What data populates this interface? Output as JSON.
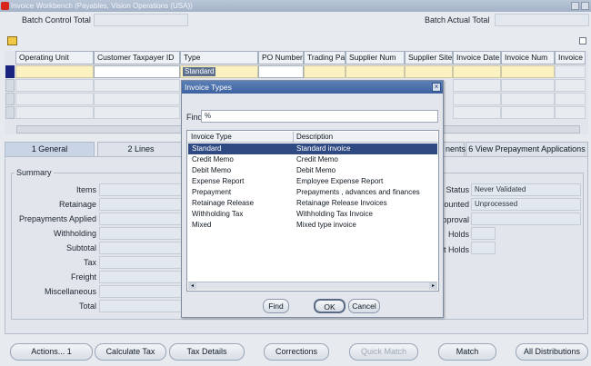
{
  "window": {
    "title": "Invoice Workbench (Payables, Vision Operations (USA))"
  },
  "header": {
    "batch_control_total_label": "Batch Control Total",
    "batch_actual_total_label": "Batch Actual Total"
  },
  "grid": {
    "columns": [
      "Operating Unit",
      "Customer Taxpayer ID",
      "Type",
      "PO Number",
      "Trading Pa",
      "Supplier Num",
      "Supplier Site",
      "Invoice Date",
      "Invoice Num",
      "Invoice"
    ],
    "current_type_value": "Standard"
  },
  "tabs": [
    {
      "label": "1 General"
    },
    {
      "label": "2 Lines"
    },
    {
      "label": "nents"
    },
    {
      "label": "6 View Prepayment Applications"
    }
  ],
  "summary": {
    "legend": "Summary",
    "labels": [
      "Items",
      "Retainage",
      "Prepayments Applied",
      "Withholding",
      "Subtotal",
      "Tax",
      "Freight",
      "Miscellaneous",
      "Total"
    ],
    "status_label": "Status",
    "status_value": "Never Validated",
    "accounted_label": "ccounted",
    "accounted_value": "Unprocessed",
    "approval_label": "pproval",
    "holds_label": "Holds",
    "release_holds_label": "t Holds"
  },
  "dialog": {
    "title": "Invoice Types",
    "find_label": "Find",
    "find_value": "%",
    "col_type": "Invoice Type",
    "col_desc": "Description",
    "rows": [
      {
        "type": "Standard",
        "desc": "Standard invoice"
      },
      {
        "type": "Credit Memo",
        "desc": "Credit Memo"
      },
      {
        "type": "Debit Memo",
        "desc": "Debit Memo"
      },
      {
        "type": "Expense Report",
        "desc": "Employee Expense Report"
      },
      {
        "type": "Prepayment",
        "desc": "Prepayments , advances and finances"
      },
      {
        "type": "Retainage Release",
        "desc": "Retainage Release Invoices"
      },
      {
        "type": "Withholding Tax",
        "desc": "Withholding Tax Invoice"
      },
      {
        "type": "Mixed",
        "desc": "Mixed type invoice"
      }
    ],
    "find_button": "Find",
    "ok_button": "OK",
    "cancel_button": "Cancel"
  },
  "buttons": {
    "actions": "Actions... 1",
    "calculate_tax": "Calculate Tax",
    "tax_details": "Tax Details",
    "corrections": "Corrections",
    "quick_match": "Quick Match",
    "match": "Match",
    "all_distributions": "All Distributions"
  },
  "colors": {
    "selection": "#2f4a82",
    "required_field": "#fcf1c0",
    "dialog_title": "#3e62a0"
  }
}
